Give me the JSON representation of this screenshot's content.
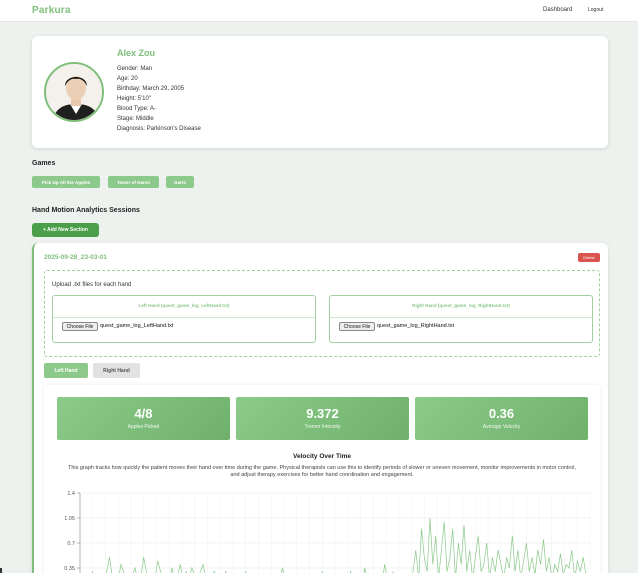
{
  "header": {
    "brand": "Parkura",
    "nav_dashboard": "Dashboard",
    "nav_logout": "Logout"
  },
  "profile": {
    "name": "Alex Zou",
    "details": [
      "Gender: Man",
      "Age: 20",
      "Birthday: March 29, 2005",
      "Height: 5'10\"",
      "Blood Type: A-",
      "Stage: Middle",
      "Diagnosis: Parkinson's Disease"
    ]
  },
  "games": {
    "title": "Games",
    "buttons": [
      "Pick Up All the Apples",
      "Tower of Hanoi",
      "Darts"
    ]
  },
  "sessions": {
    "title": "Hand Motion Analytics Sessions",
    "add_label": "+ Add New Section",
    "session": {
      "title": "2025-09-28_23-03-01",
      "delete_label": "Delete",
      "upload_title": "Upload .txt files for each hand",
      "left_box_title": "Left Hand (quest_game_log_LeftHand.txt)",
      "right_box_title": "Right Hand (quest_game_log_RightHand.txt)",
      "choose_label": "Choose File",
      "left_file": "quest_game_log_LeftHand.txt",
      "right_file": "quest_game_log_RightHand.txt",
      "tabs": [
        "Left Hand",
        "Right Hand"
      ],
      "active_tab": "Left Hand",
      "stats": [
        {
          "value": "4/8",
          "label": "Apples Picked"
        },
        {
          "value": "9.372",
          "label": "Tremor Intensity"
        },
        {
          "value": "0.36",
          "label": "Average Velocity"
        }
      ],
      "chart_title": "Velocity Over Time",
      "chart_description": "This graph tracks how quickly the patient moves their hand over time during the game. Physical therapists can use this to identify periods of slower or uneven movement, monitor improvements in motor control, and adjust therapy exercises for better hand coordination and engagement."
    }
  },
  "colors": {
    "accent": "#7fbf7b",
    "accent_dark": "#4b9e4a",
    "delete": "#d9534f"
  },
  "chart_data": {
    "type": "line",
    "title": "Velocity Over Time",
    "y_ticks": [
      "1.4",
      "1.05",
      "0.7",
      "0.35"
    ],
    "ylim": [
      0,
      1.4
    ],
    "series": [
      {
        "values": [
          0.1,
          0.2,
          0.15,
          0.3,
          0.1,
          0.2,
          0.25,
          0.1,
          0.3,
          0.5,
          0.2,
          0.1,
          0.15,
          0.4,
          0.3,
          0.1,
          0.2,
          0.25,
          0.35,
          0.15,
          0.2,
          0.5,
          0.3,
          0.15,
          0.25,
          0.2,
          0.45,
          0.3,
          0.15,
          0.2,
          0.1,
          0.35,
          0.2,
          0.25,
          0.4,
          0.15,
          0.3,
          0.2,
          0.35,
          0.25,
          0.15,
          0.3,
          0.4,
          0.2,
          0.1,
          0.25,
          0.3,
          0.2,
          0.15,
          0.2,
          0.3,
          0.1,
          0.2,
          0.25,
          0.15,
          0.1,
          0.2,
          0.3,
          0.15,
          0.2,
          0.1,
          0.15,
          0.25,
          0.2,
          0.1,
          0.15,
          0.2,
          0.1,
          0.15,
          0.2,
          0.35,
          0.15,
          0.2,
          0.1,
          0.15,
          0.2,
          0.1,
          0.25,
          0.15,
          0.2,
          0.1,
          0.2,
          0.15,
          0.1,
          0.3,
          0.2,
          0.15,
          0.25,
          0.1,
          0.2,
          0.15,
          0.2,
          0.1,
          0.15,
          0.3,
          0.2,
          0.1,
          0.25,
          0.15,
          0.35,
          0.2,
          0.1,
          0.25,
          0.15,
          0.2,
          0.1,
          0.4,
          0.2,
          0.15,
          0.3,
          0.1,
          0.2,
          0.15,
          0.25,
          0.2,
          0.1,
          0.3,
          0.6,
          0.2,
          0.9,
          0.5,
          0.3,
          1.05,
          0.4,
          0.8,
          0.2,
          0.6,
          1.0,
          0.3,
          0.5,
          0.9,
          0.2,
          0.7,
          0.4,
          0.95,
          0.3,
          0.6,
          0.2,
          0.5,
          0.8,
          0.3,
          0.4,
          0.7,
          0.2,
          0.5,
          0.3,
          0.6,
          0.4,
          0.2,
          0.5,
          0.35,
          0.8,
          0.3,
          0.6,
          0.2,
          0.45,
          0.7,
          0.3,
          0.5,
          0.25,
          0.6,
          0.4,
          0.75,
          0.3,
          0.5,
          0.2,
          0.4,
          0.3,
          0.55,
          0.25,
          0.4,
          0.35,
          0.6,
          0.2,
          0.45,
          0.3,
          0.5,
          0.25
        ]
      }
    ]
  }
}
